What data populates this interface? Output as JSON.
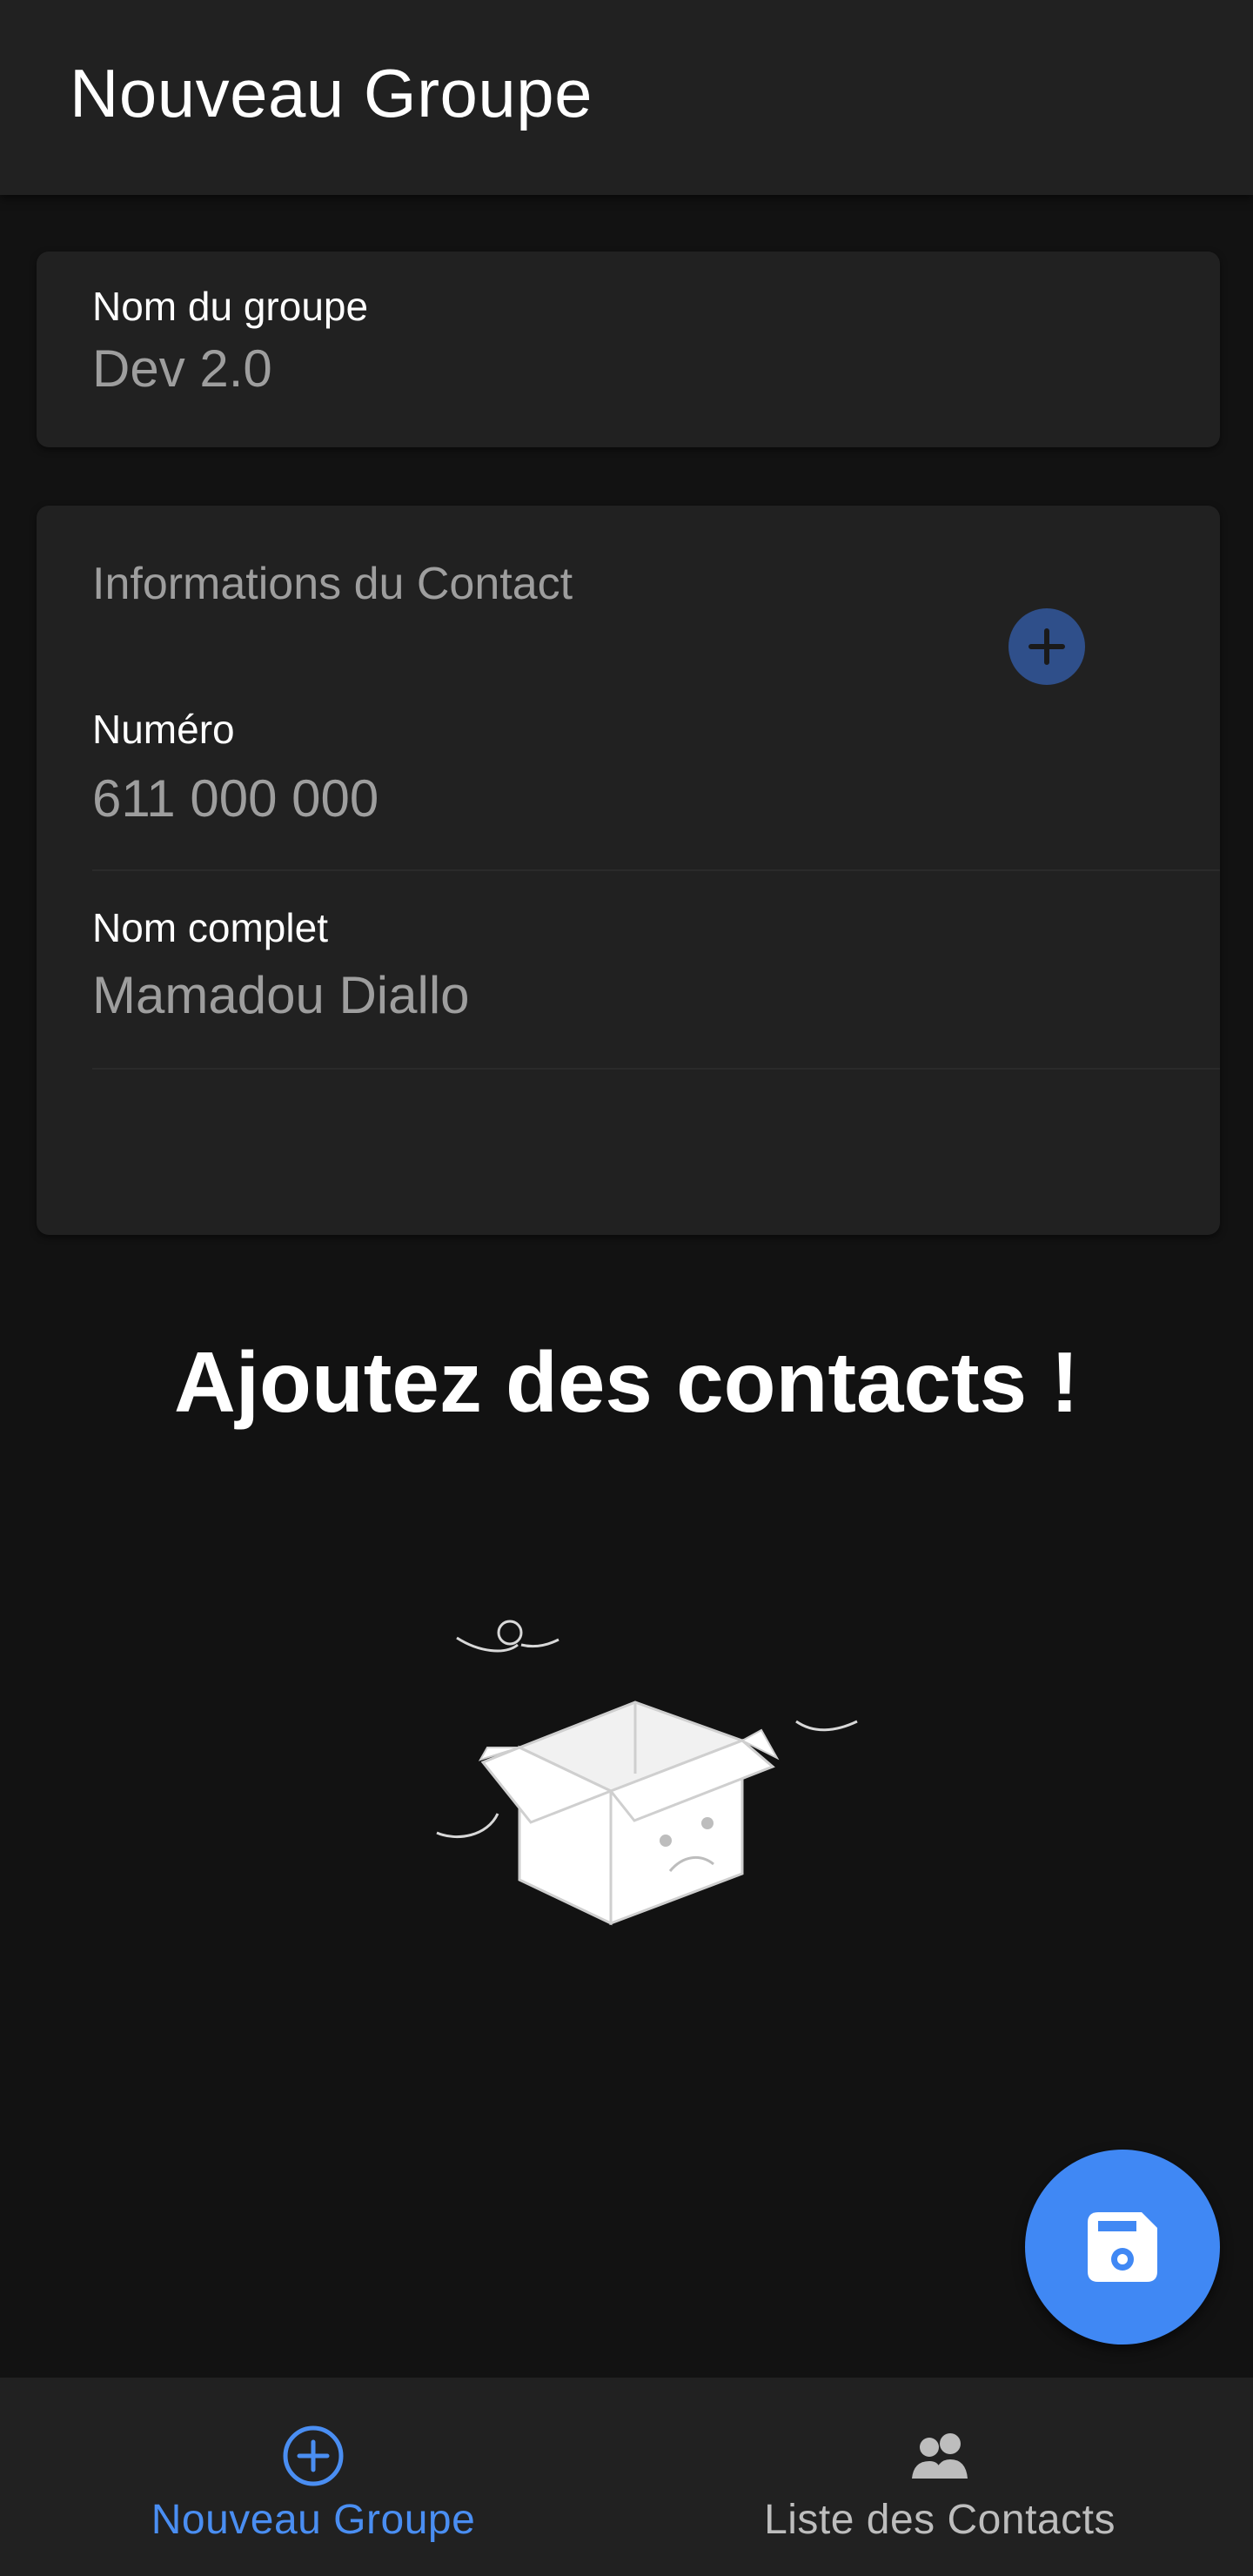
{
  "app_bar": {
    "title": "Nouveau Groupe"
  },
  "group_card": {
    "label": "Nom du groupe",
    "value": "Dev 2.0"
  },
  "contact_card": {
    "title": "Informations du Contact",
    "number_label": "Numéro",
    "number_value": "611 000 000",
    "name_label": "Nom complet",
    "name_value": "Mamadou Diallo",
    "add_icon": "plus-icon"
  },
  "empty_state": {
    "title": "Ajoutez des contacts !",
    "illustration": "empty-box-illustration"
  },
  "fab": {
    "icon": "save-icon"
  },
  "bottom_nav": {
    "items": [
      {
        "label": "Nouveau Groupe",
        "icon": "add-circle-icon",
        "active": true
      },
      {
        "label": "Liste des Contacts",
        "icon": "people-icon",
        "active": false
      }
    ]
  },
  "colors": {
    "background": "#121212",
    "surface": "#212121",
    "accent": "#4088f4",
    "muted_text": "#9e9e9e"
  }
}
